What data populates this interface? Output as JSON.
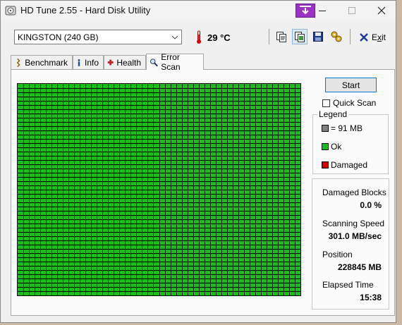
{
  "window": {
    "title": "HD Tune 2.55 - Hard Disk Utility"
  },
  "toolbar": {
    "drive": "KINGSTON (240 GB)",
    "temperature": "29 °C",
    "exit_label": "Exit",
    "exit_accel_char": "x"
  },
  "tabs": [
    {
      "label": "Benchmark",
      "icon": "chart-icon",
      "active": false
    },
    {
      "label": "Info",
      "icon": "info-icon",
      "active": false
    },
    {
      "label": "Health",
      "icon": "health-icon",
      "active": false
    },
    {
      "label": "Error Scan",
      "icon": "magnifier-icon",
      "active": true
    }
  ],
  "scan": {
    "start_label": "Start",
    "quick_scan_label": "Quick Scan",
    "quick_scan_checked": false,
    "legend": {
      "title": "Legend",
      "items": [
        {
          "label": "= 91 MB",
          "color": "#808080"
        },
        {
          "label": "Ok",
          "color": "#16c016"
        },
        {
          "label": "Damaged",
          "color": "#d40000"
        }
      ]
    },
    "stats": {
      "damaged_blocks_label": "Damaged Blocks",
      "damaged_blocks_value": "0.0 %",
      "scanning_speed_label": "Scanning Speed",
      "scanning_speed_value": "301.0 MB/sec",
      "position_label": "Position",
      "position_value": "228845 MB",
      "elapsed_time_label": "Elapsed Time",
      "elapsed_time_value": "15:38"
    },
    "block_status": "ok",
    "colors": {
      "ok": "#16c016",
      "grid": "#000000"
    }
  }
}
